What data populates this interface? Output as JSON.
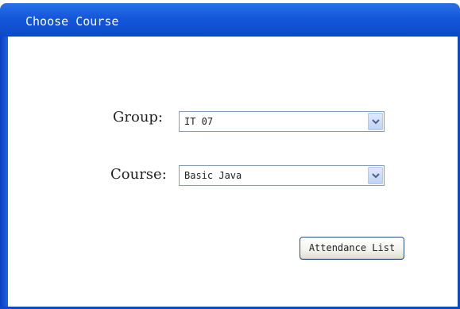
{
  "window": {
    "title": "Choose Course"
  },
  "form": {
    "group": {
      "label": "Group:",
      "selected": "IT 07"
    },
    "course": {
      "label": "Course:",
      "selected": "Basic Java"
    },
    "attendance_button": "Attendance List"
  },
  "colors": {
    "titlebar": "#1457d9",
    "frame": "#0b49c9",
    "field_border": "#7f9db9",
    "button_border": "#2b4f82"
  },
  "icons": {
    "dropdown": "chevron-down-icon"
  }
}
